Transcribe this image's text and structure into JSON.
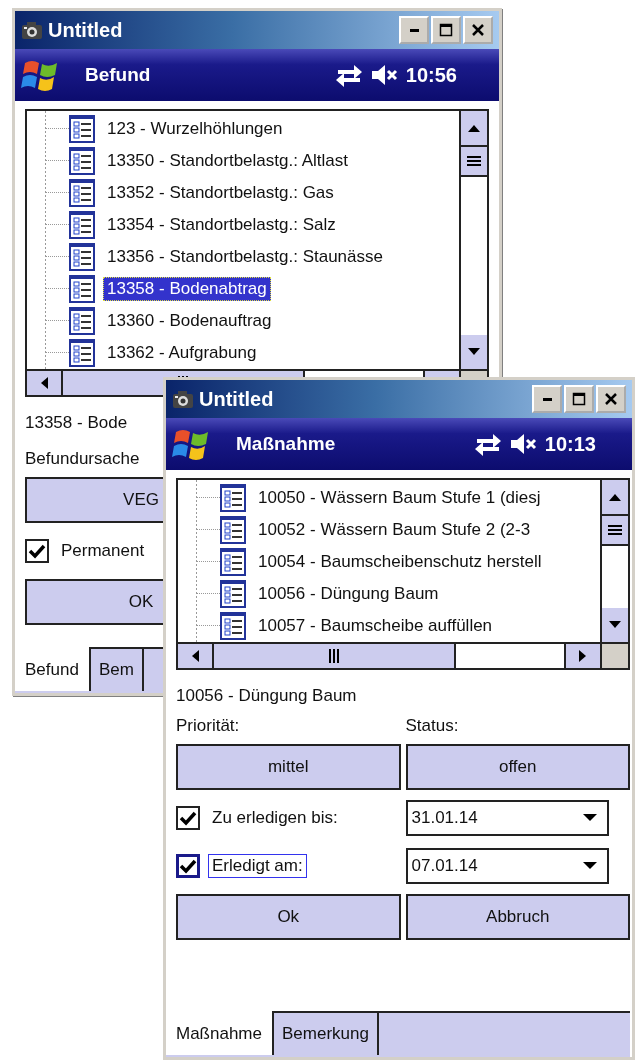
{
  "windows": [
    {
      "title": "Untitled",
      "app_title": "Befund",
      "time": "10:56",
      "tree": [
        {
          "label": "123 - Wurzelhöhlungen",
          "selected": false
        },
        {
          "label": "13350 - Standortbelastg.: Altlast",
          "selected": false
        },
        {
          "label": "13352 - Standortbelastg.: Gas",
          "selected": false
        },
        {
          "label": "13354 - Standortbelastg.: Salz",
          "selected": false
        },
        {
          "label": "13356 - Standortbelastg.: Staunässe",
          "selected": false
        },
        {
          "label": "13358 - Bodenabtrag",
          "selected": true
        },
        {
          "label": "13360 - Bodenauftrag",
          "selected": false
        },
        {
          "label": "13362 - Aufgrabung",
          "selected": false
        }
      ],
      "body": [
        {
          "kind": "text",
          "text": "13358 - Bode"
        },
        {
          "kind": "text",
          "text": "Befundursache"
        },
        {
          "kind": "buttons",
          "buttons": [
            "VEG"
          ]
        },
        {
          "kind": "check",
          "label": "Permanent",
          "checked": true,
          "focused": false
        },
        {
          "kind": "buttons",
          "buttons": [
            "OK"
          ]
        }
      ],
      "tabs": [
        {
          "label": "Befund",
          "selected": true
        },
        {
          "label": "Bem",
          "selected": false
        }
      ]
    },
    {
      "title": "Untitled",
      "app_title": "Maßnahme",
      "time": "10:13",
      "tree": [
        {
          "label": "10050 - Wässern Baum Stufe 1 (diesj",
          "selected": false
        },
        {
          "label": "10052 - Wässern Baum Stufe 2 (2-3",
          "selected": false
        },
        {
          "label": "10054 - Baumscheibenschutz herstell",
          "selected": false
        },
        {
          "label": "10056 - Düngung Baum",
          "selected": false
        },
        {
          "label": "10057 - Baumscheibe auffüllen",
          "selected": false
        }
      ],
      "body": [
        {
          "kind": "text",
          "text": "10056 - Düngung Baum"
        },
        {
          "kind": "labels",
          "labels": [
            "Priorität:",
            "Status:"
          ]
        },
        {
          "kind": "buttons",
          "buttons": [
            "mittel",
            "offen"
          ]
        },
        {
          "kind": "check",
          "label": "Zu erledigen bis:",
          "checked": true,
          "focused": false,
          "date": "31.01.14"
        },
        {
          "kind": "check",
          "label": "Erledigt am:",
          "checked": true,
          "focused": true,
          "date": "07.01.14"
        },
        {
          "kind": "buttons",
          "buttons": [
            "Ok",
            "Abbruch"
          ]
        }
      ],
      "tabs": [
        {
          "label": "Maßnahme",
          "selected": true
        },
        {
          "label": "Bemerkung",
          "selected": false
        }
      ]
    }
  ]
}
